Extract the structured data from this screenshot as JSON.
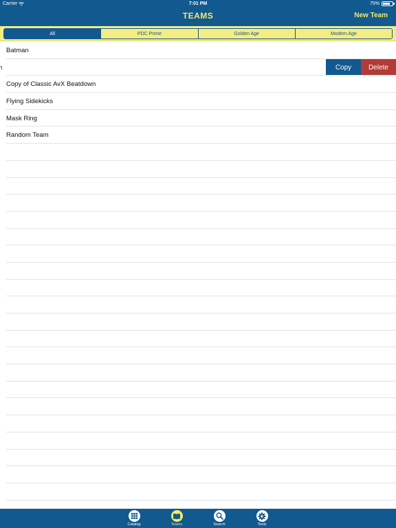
{
  "status_bar": {
    "carrier": "Carrier",
    "time": "7:01 PM",
    "battery": "75%",
    "battery_level": 0.75
  },
  "nav": {
    "title": "TEAMS",
    "new_team_label": "New Team"
  },
  "segments": {
    "items": [
      "All",
      "PDC Prime",
      "Golden Age",
      "Modern Age"
    ],
    "selected": "All"
  },
  "teams": {
    "rows": [
      "Batman",
      "n",
      "Copy of Classic AvX Beatdown",
      "Flying Sidekicks",
      "Mask Ring",
      "Random Team"
    ],
    "swipe_actions": {
      "copy_label": "Copy",
      "delete_label": "Delete"
    }
  },
  "tab_bar": {
    "items": [
      {
        "label": "Catalog",
        "icon": "catalog-grid-icon"
      },
      {
        "label": "Teams",
        "icon": "teams-book-icon"
      },
      {
        "label": "Search",
        "icon": "search-icon"
      },
      {
        "label": "Tools",
        "icon": "gear-icon"
      }
    ],
    "selected": "Teams"
  },
  "colors": {
    "primary": "#12598f",
    "accent": "#f4ea6a",
    "segment_bg": "#f5ec83",
    "delete": "#b23a37"
  }
}
